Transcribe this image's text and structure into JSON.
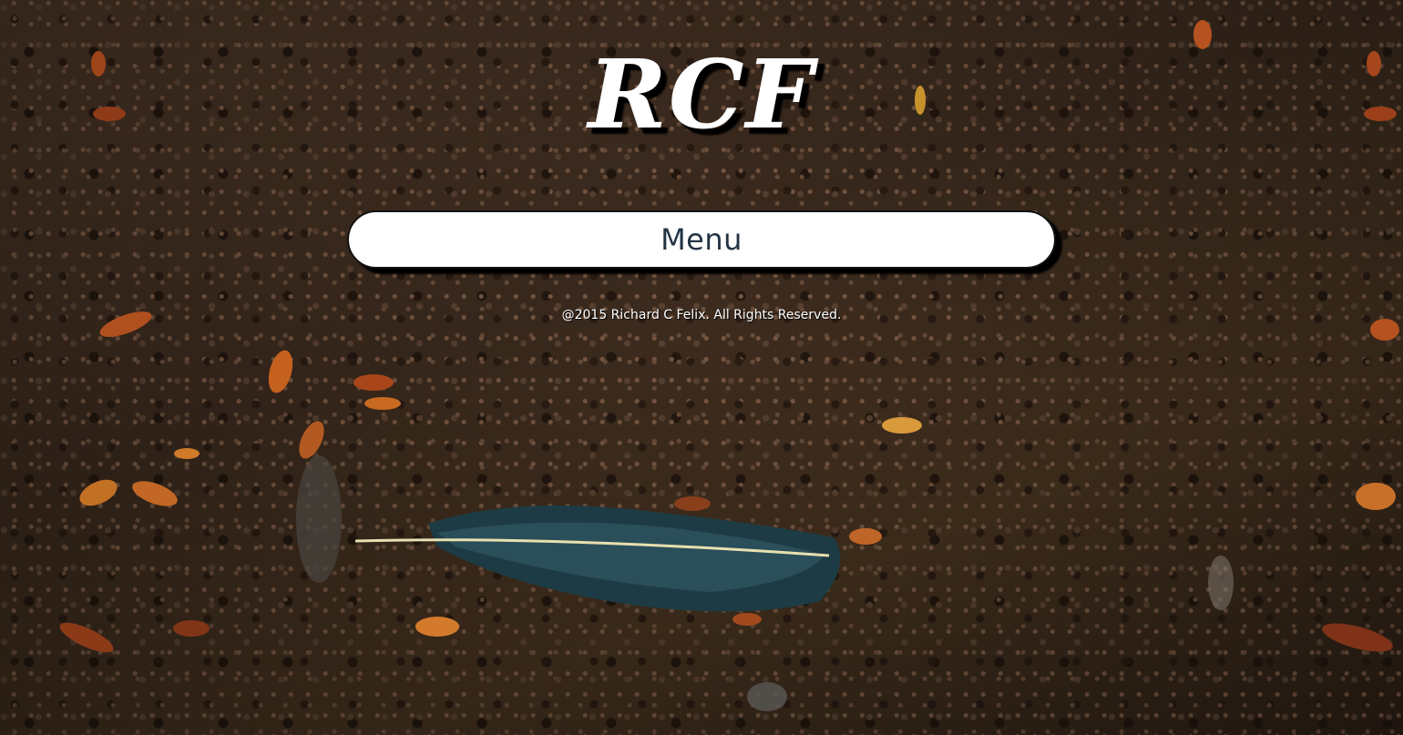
{
  "logo": {
    "text": "RCF"
  },
  "nav": {
    "menu_label": "Menu"
  },
  "footer": {
    "copyright": "@2015 Richard C Felix. All Rights Reserved."
  },
  "colors": {
    "menu_text": "#243444",
    "menu_background": "#ffffff",
    "logo": "#ffffff"
  },
  "background": {
    "icon": "soil-with-feather-photo"
  }
}
